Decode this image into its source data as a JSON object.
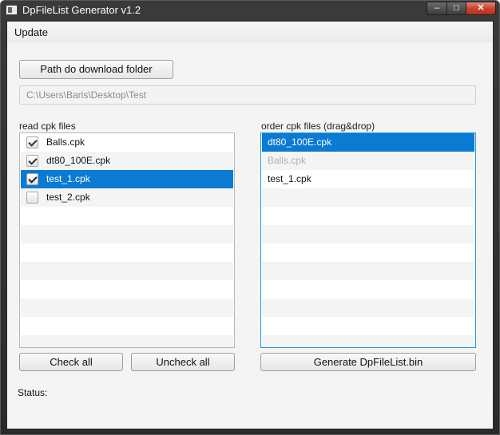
{
  "window": {
    "title": "DpFileList Generator v1.2",
    "icon": "app-window-icon"
  },
  "menu": {
    "items": [
      "Update"
    ]
  },
  "path": {
    "button_label": "Path do download folder",
    "value": "C:\\Users\\Baris\\Desktop\\Test"
  },
  "read_list": {
    "label": "read cpk files",
    "items": [
      {
        "name": "Balls.cpk",
        "checked": true
      },
      {
        "name": "dt80_100E.cpk",
        "checked": true
      },
      {
        "name": "test_1.cpk",
        "checked": true,
        "selected": true
      },
      {
        "name": "test_2.cpk",
        "checked": false
      }
    ]
  },
  "order_list": {
    "label": "order cpk files (drag&drop)",
    "items": [
      "dt80_100E.cpk",
      "Balls.cpk",
      "test_1.cpk"
    ]
  },
  "buttons": {
    "check_all": "Check all",
    "uncheck_all": "Uncheck all",
    "generate": "Generate DpFileList.bin"
  },
  "status": {
    "label": "Status:"
  },
  "colors": {
    "selection": "#0a7ad2",
    "focus_border": "#1b9ad3",
    "close_button": "#c8442e"
  }
}
